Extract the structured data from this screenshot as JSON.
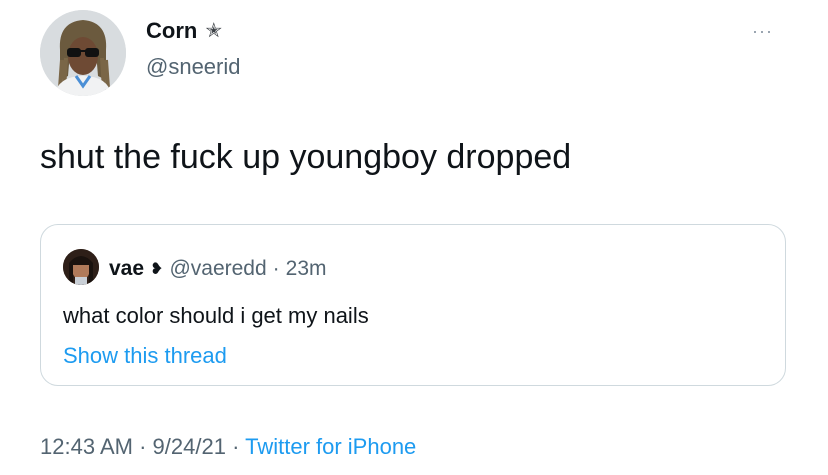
{
  "author": {
    "name": "Corn",
    "badge_icon": "star-icon",
    "badge_glyph": "✭",
    "handle": "@sneerid"
  },
  "more_glyph": "···",
  "tweet": {
    "text": "shut the fuck up youngboy dropped"
  },
  "quote": {
    "name": "vae",
    "badge_glyph": "❥",
    "handle": "@vaeredd",
    "separator": "·",
    "time": "23m",
    "text": "what color should i get my nails",
    "show_thread": "Show this thread"
  },
  "meta": {
    "time": "12:43 AM",
    "sep1": "·",
    "date": "9/24/21",
    "sep2": "·",
    "source": "Twitter for iPhone"
  },
  "colors": {
    "link": "#1d9bf0",
    "secondary_text": "#536471",
    "border": "#cfd9de"
  }
}
